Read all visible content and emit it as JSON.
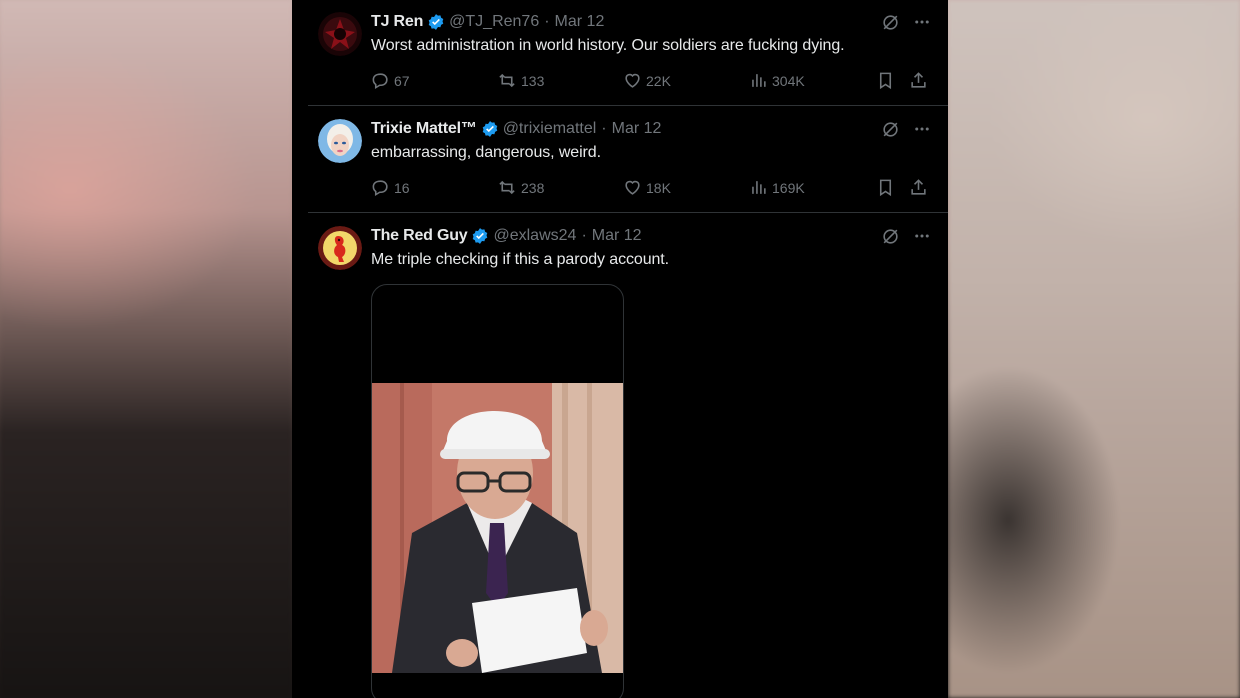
{
  "tweets": [
    {
      "name": "TJ Ren",
      "handle": "@TJ_Ren76",
      "date": "Mar 12",
      "text": "Worst administration in world history. Our soldiers are fucking dying.",
      "replies": "67",
      "reposts": "133",
      "likes": "22K",
      "views": "304K"
    },
    {
      "name": "Trixie Mattel™",
      "handle": "@trixiemattel",
      "date": "Mar 12",
      "text": "embarrassing, dangerous, weird.",
      "replies": "16",
      "reposts": "238",
      "likes": "18K",
      "views": "169K"
    },
    {
      "name": "The Red Guy",
      "handle": "@exlaws24",
      "date": "Mar 12",
      "text": "Me triple checking if this a parody account."
    }
  ],
  "colors": {
    "background": "#000000",
    "primary_text": "#e7e9ea",
    "secondary_text": "#71767b",
    "verified_blue": "#1d9bf0",
    "divider": "#2f3336"
  },
  "icons": [
    "verified-badge-icon",
    "grok-icon",
    "more-icon",
    "reply-icon",
    "repost-icon",
    "like-icon",
    "views-icon",
    "bookmark-icon",
    "share-icon"
  ]
}
